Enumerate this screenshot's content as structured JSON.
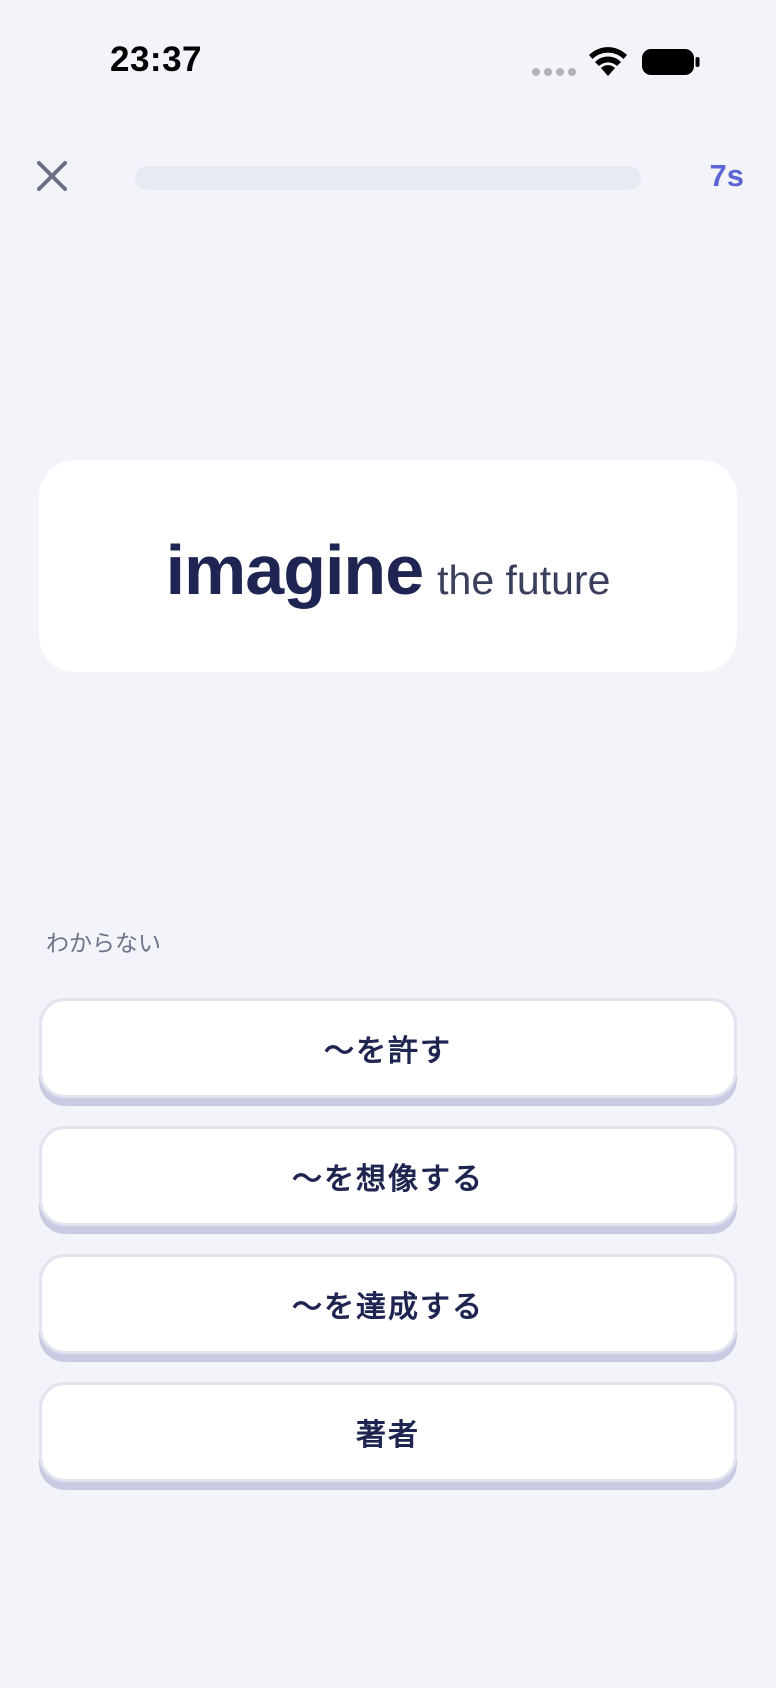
{
  "status_bar": {
    "time": "23:37",
    "icons": [
      "signal-icon",
      "wifi-icon",
      "battery-icon"
    ]
  },
  "top_bar": {
    "close_icon": "close-icon",
    "progress": 0.0,
    "timer": "7s"
  },
  "prompt": {
    "word": "imagine",
    "context": "the future"
  },
  "dont_know_label": "わからない",
  "options": [
    {
      "label": "〜を許す"
    },
    {
      "label": "〜を想像する"
    },
    {
      "label": "〜を達成する"
    },
    {
      "label": "著者"
    }
  ],
  "colors": {
    "background": "#f3f4f9",
    "accent": "#5b63d3",
    "text_dark": "#1e2553",
    "option_shadow": "#c6cbe2"
  }
}
